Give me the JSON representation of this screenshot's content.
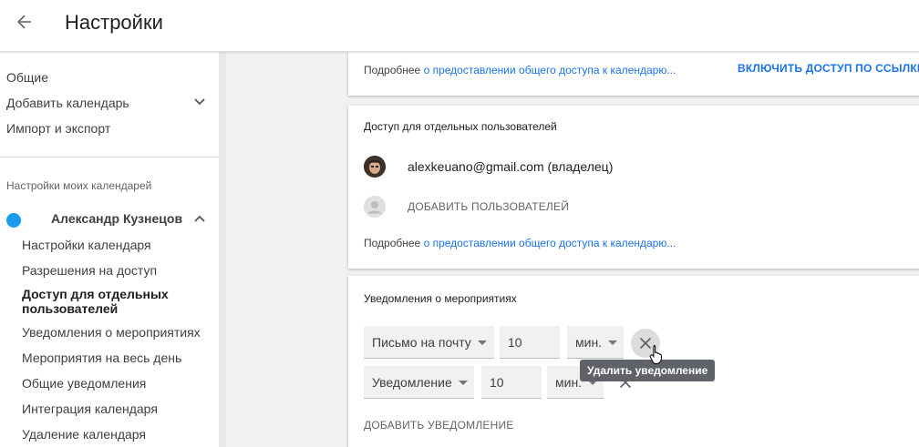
{
  "header": {
    "title": "Настройки",
    "back_icon": "arrow-back-icon"
  },
  "sidebar": {
    "top_items": [
      {
        "label": "Общие"
      },
      {
        "label": "Добавить календарь"
      },
      {
        "label": "Импорт и экспорт"
      }
    ],
    "section_title": "Настройки моих календарей",
    "calendar": {
      "name": "Александр Кузнецов",
      "color": "#1a9bf0"
    },
    "sub_items": [
      {
        "label": "Настройки календаря"
      },
      {
        "label": "Разрешения на доступ"
      },
      {
        "label": "Доступ для отдельных пользователей",
        "line1": "Доступ для отдельных",
        "line2": "пользователей",
        "active": true
      },
      {
        "label": "Уведомления о мероприятиях"
      },
      {
        "label": "Мероприятия на весь день"
      },
      {
        "label": "Общие уведомления"
      },
      {
        "label": "Интеграция календаря"
      },
      {
        "label": "Удаление календаря"
      }
    ]
  },
  "card_access": {
    "more_prefix": "Подробнее",
    "more_link": "о предоставлении общего доступа к календарю...",
    "enable_link_button": "ВКЛЮЧИТЬ ДОСТУП ПО ССЫЛКЕ"
  },
  "card_users": {
    "title": "Доступ для отдельных пользователей",
    "owner": "alexkeuano@gmail.com (владелец)",
    "add_users": "ДОБАВИТЬ ПОЛЬЗОВАТЕЛЕЙ",
    "more_prefix": "Подробнее",
    "more_link": "о предоставлении общего доступа к календарю..."
  },
  "card_notifications": {
    "title": "Уведомления о мероприятиях",
    "rows": [
      {
        "type": "Письмо на почту",
        "value": "10",
        "unit": "мин."
      },
      {
        "type": "Уведомление",
        "value": "10",
        "unit": "мин."
      }
    ],
    "add_button": "ДОБАВИТЬ УВЕДОМЛЕНИЕ",
    "tooltip": "Удалить уведомление"
  },
  "colors": {
    "accent": "#1a73e8",
    "calendar_dot": "#1a9bf0",
    "background": "#f1f1f1"
  }
}
